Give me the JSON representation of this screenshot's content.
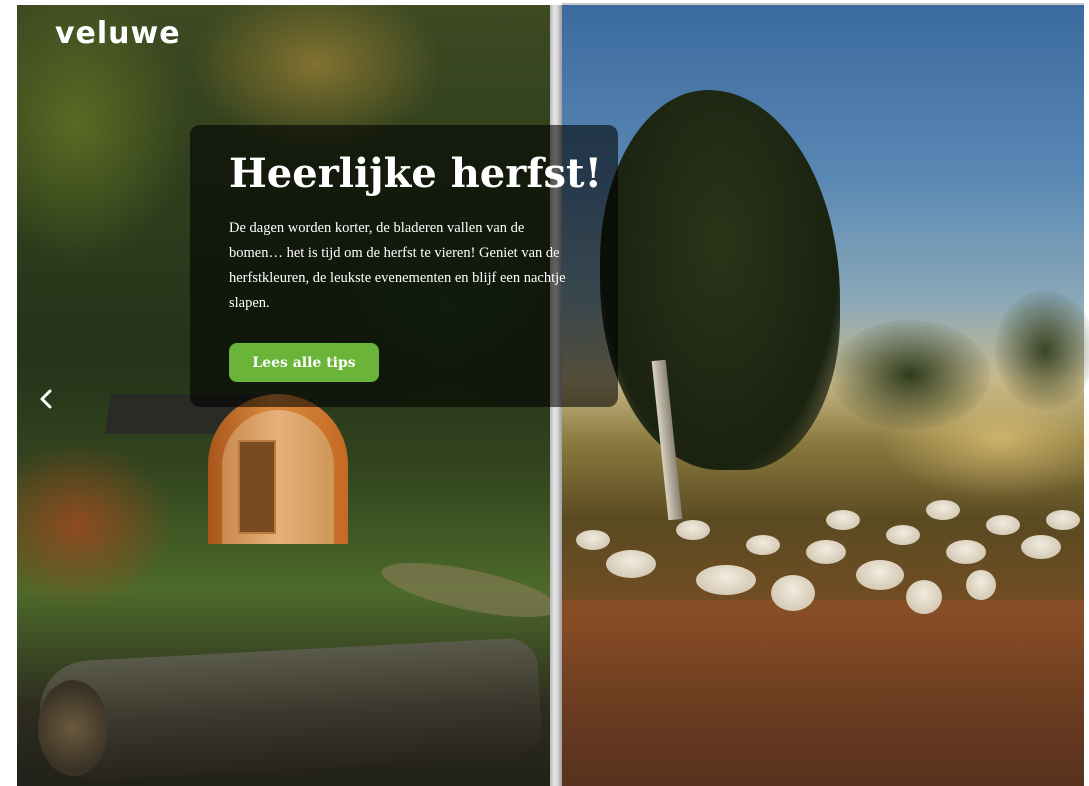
{
  "brand": {
    "logo_text": "veluwe"
  },
  "hero": {
    "title": "Heerlijke herfst!",
    "description": "De dagen worden korter, de bladeren vallen van de bomen… het is tijd om de herfst te vieren! Geniet van de herfstkleuren, de leukste evenementen en blijf een nachtje slapen.",
    "cta_label": "Lees alle tips",
    "cta_color": "#6ab43a"
  },
  "carousel": {
    "prev_icon": "chevron-left-icon",
    "slides": [
      {
        "image": "forest-eco-pod-photo"
      },
      {
        "image": "heath-sheep-flock-photo"
      }
    ]
  }
}
